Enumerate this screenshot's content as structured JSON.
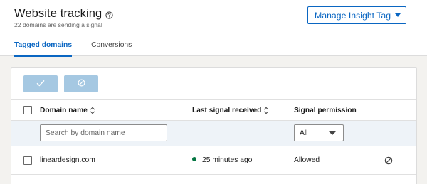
{
  "header": {
    "title": "Website tracking",
    "subtitle": "22 domains are sending a signal",
    "manage_button_label": "Manage Insight Tag"
  },
  "tabs": [
    {
      "label": "Tagged domains",
      "active": true
    },
    {
      "label": "Conversions",
      "active": false
    }
  ],
  "toolbar": {
    "approve_icon": "checkmark-icon",
    "block_icon": "block-icon"
  },
  "table": {
    "columns": [
      {
        "label": "Domain name",
        "sortable": true
      },
      {
        "label": "Last signal received",
        "sortable": true
      },
      {
        "label": "Signal permission",
        "sortable": false
      }
    ],
    "filters": {
      "domain_placeholder": "Search by domain name",
      "permission_selected": "All"
    },
    "rows": [
      {
        "domain": "lineardesign.com",
        "last_signal": "25 minutes ago",
        "status_color": "#057642",
        "permission": "Allowed"
      }
    ]
  },
  "colors": {
    "accent": "#0a66c2",
    "disabled_button": "#a5c8e2",
    "status_green": "#057642",
    "filter_background": "#eef3f8"
  }
}
